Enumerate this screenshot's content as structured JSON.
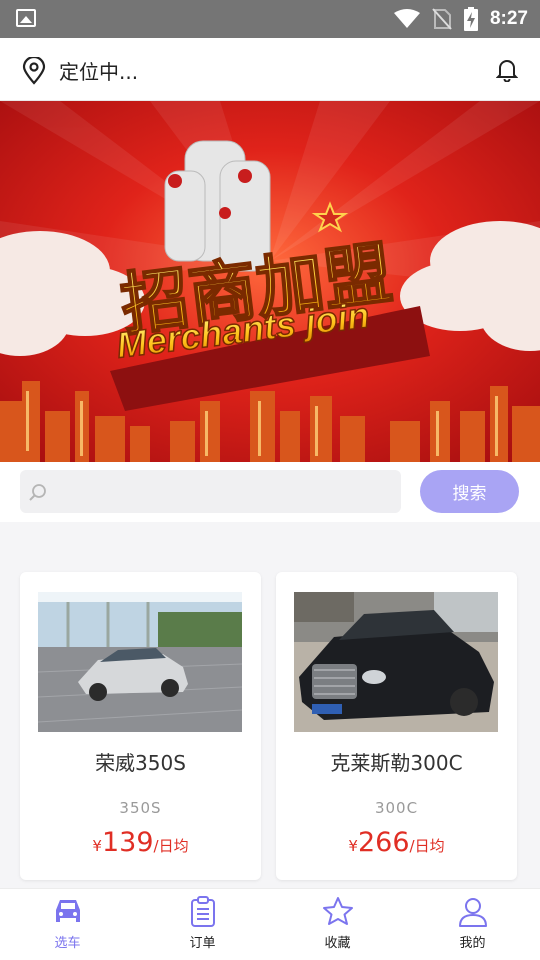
{
  "status_bar": {
    "time": "8:27"
  },
  "header": {
    "location_text": "定位中..."
  },
  "banner": {
    "title_cn": "招商加盟",
    "title_en": "Merchants join"
  },
  "search": {
    "placeholder": "",
    "button_label": "搜索"
  },
  "cars": [
    {
      "name": "荣威350S",
      "model": "350S",
      "currency": "¥",
      "price": "139",
      "unit": "/日均"
    },
    {
      "name": "克莱斯勒300C",
      "model": "300C",
      "currency": "¥",
      "price": "266",
      "unit": "/日均"
    }
  ],
  "tabs": [
    {
      "label": "选车",
      "icon": "car-icon",
      "active": true
    },
    {
      "label": "订单",
      "icon": "clipboard-icon",
      "active": false
    },
    {
      "label": "收藏",
      "icon": "star-icon",
      "active": false
    },
    {
      "label": "我的",
      "icon": "person-icon",
      "active": false
    }
  ],
  "colors": {
    "accent": "#a9a4f4",
    "active_tab": "#7b74ee",
    "price": "#e02e24",
    "status_bar": "#757575"
  }
}
